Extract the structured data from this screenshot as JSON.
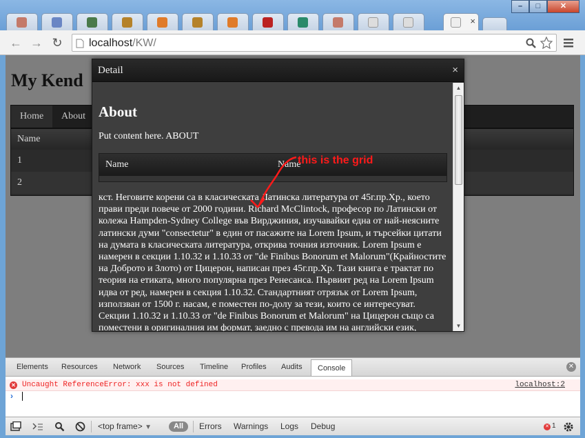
{
  "browser": {
    "tabs": [
      {
        "icon": "people-icon",
        "color": "#c47a6a"
      },
      {
        "icon": "coffee-cup-icon",
        "color": "#6a86c4"
      },
      {
        "icon": "code-brackets-icon",
        "color": "#4a7a4a"
      },
      {
        "icon": "asterisk-icon",
        "color": "#b5822a"
      },
      {
        "icon": "stack-icon",
        "color": "#e07b2a"
      },
      {
        "icon": "asterisk-icon",
        "color": "#b5822a"
      },
      {
        "icon": "stack-icon",
        "color": "#e07b2a"
      },
      {
        "icon": "bird-icon",
        "color": "#b22"
      },
      {
        "icon": "plus-box-icon",
        "color": "#2a8a6a"
      },
      {
        "icon": "people-icon",
        "color": "#c47a6a"
      },
      {
        "icon": "page-icon",
        "color": "#ddd"
      },
      {
        "icon": "page-icon",
        "color": "#ddd"
      },
      {
        "icon": "page-icon",
        "color": "#eee"
      }
    ],
    "active_tab_close": "×",
    "window_buttons": {
      "minimize": "–",
      "maximize": "□",
      "close": "✕"
    },
    "url_host": "localhost",
    "url_path": "/KW/"
  },
  "page": {
    "heading": "My Kend",
    "menu": [
      "Home",
      "About"
    ],
    "grid_header": "Name",
    "grid_rows": [
      "1",
      "2"
    ]
  },
  "window": {
    "title": "Detail",
    "close": "×",
    "about_title": "About",
    "about_intro": "Put content here. ABOUT",
    "grid_headers": [
      "Name",
      "Name"
    ],
    "body_text": "кст. Неговите корени са в класическата Латинска литература от 45г.пр.Хр., което прави преди повече от 2000 години. Richard McClintock, професор по Латински от колежа Hampden-Sydney College във Вирджиния, изучавайки една от най-неясните латински думи \"consectetur\" в един от пасажите на Lorem Ipsum, и търсейки цитати на думата в класическата литература, открива точния източник. Lorem Ipsum е намерен в секции 1.10.32 и 1.10.33 от \"de Finibus Bonorum et Malorum\"(Крайностите на Доброто и Злото) от Цицерон, написан през 45г.пр.Хр. Тази книга е трактат по теория на етиката, много популярна през Ренесанса. Първият ред на Lorem Ipsum идва от ред, намерен в секция 1.10.32. Стандартният отрязък от Lorem Ipsum, използван от 1500 г. насам, е поместен по-долу за тези, които се интересуват. Секции 1.10.32 и 1.10.33 от \"de Finibus Bonorum et Malorum\" на Цицерон също са поместени в оригиналния им формат, заедно с превода им на английски език,"
  },
  "annotation": {
    "text": "this is the grid",
    "color": "#ff1a1a"
  },
  "devtools": {
    "tabs": [
      "Elements",
      "Resources",
      "Network",
      "Sources",
      "Timeline",
      "Profiles",
      "Audits",
      "Console"
    ],
    "active_tab": "Console",
    "error_message": "Uncaught ReferenceError: xxx is not defined",
    "error_source": "localhost:2",
    "prompt": "›",
    "frame_select": "<top frame>",
    "filters": [
      "All",
      "Errors",
      "Warnings",
      "Logs",
      "Debug"
    ],
    "error_count": "1"
  }
}
